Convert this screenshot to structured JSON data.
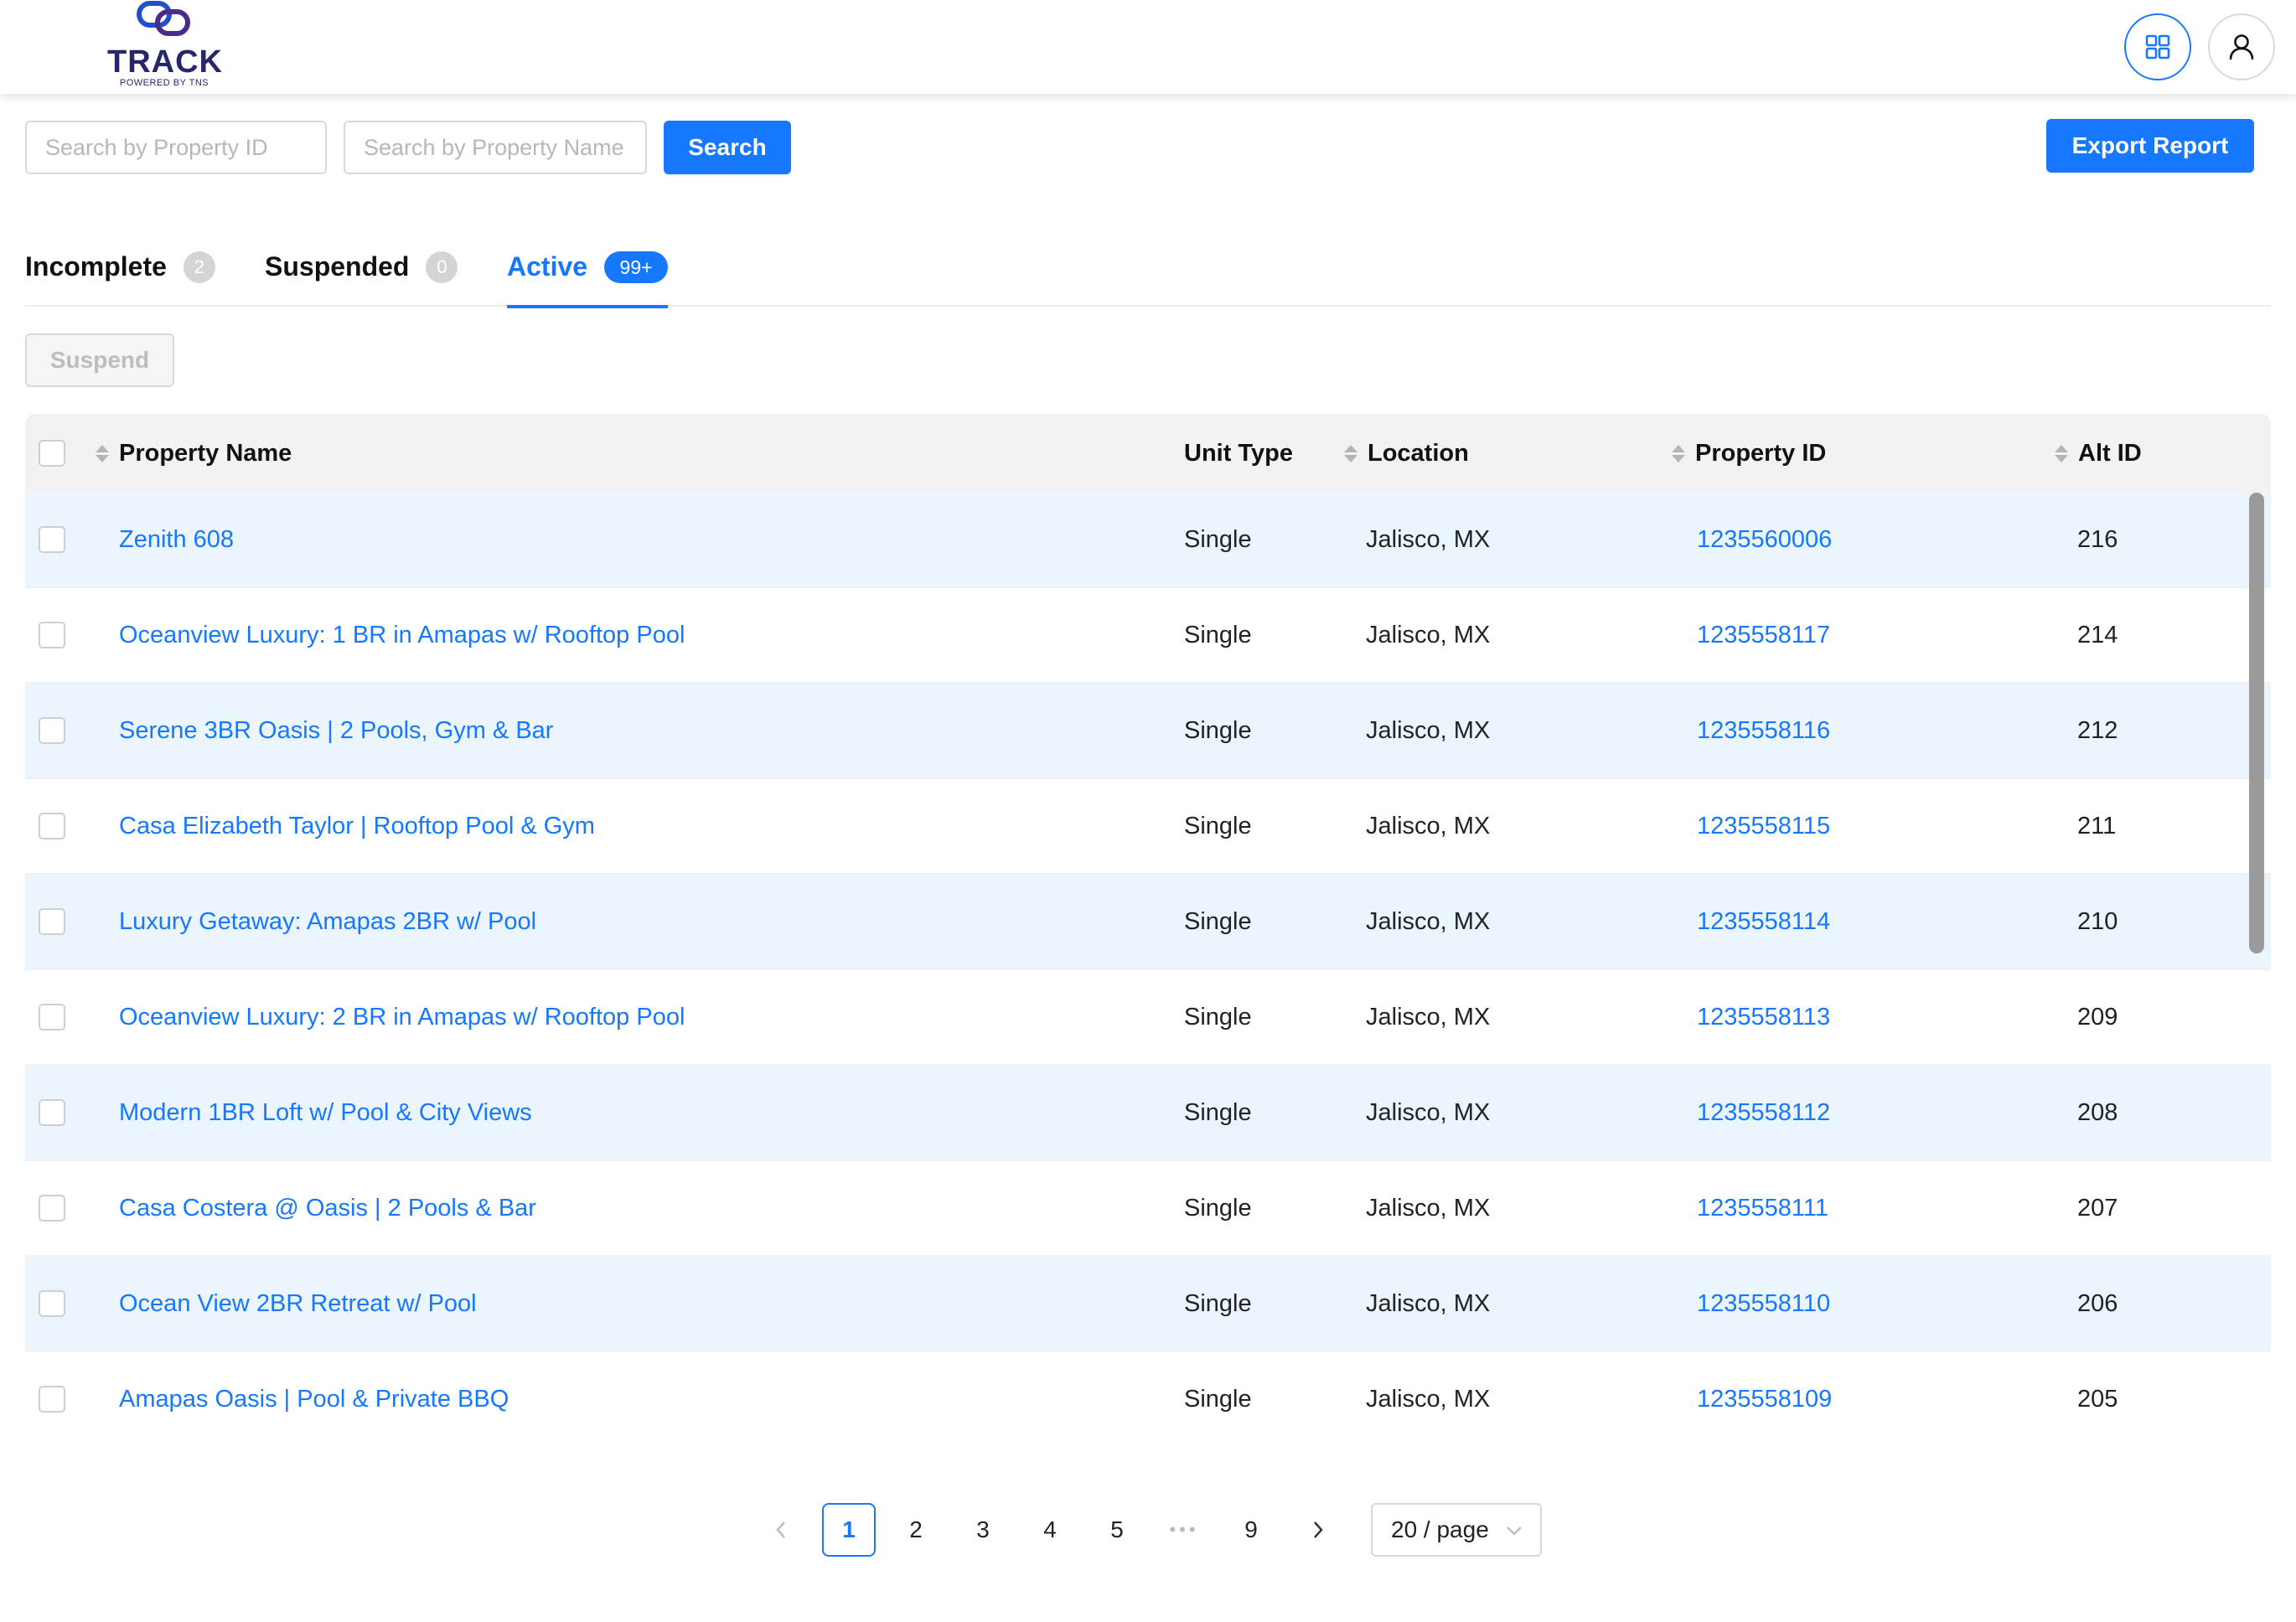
{
  "header": {
    "logo_text": "TRACK",
    "logo_sub": "POWERED BY TNS",
    "apps_icon": "grid-icon",
    "user_icon": "user-icon"
  },
  "toolbar": {
    "search_id_placeholder": "Search by Property ID",
    "search_name_placeholder": "Search by Property Name",
    "search_label": "Search",
    "export_label": "Export Report"
  },
  "tabs": [
    {
      "label": "Incomplete",
      "count": "2",
      "active": false
    },
    {
      "label": "Suspended",
      "count": "0",
      "active": false
    },
    {
      "label": "Active",
      "count": "99+",
      "active": true
    }
  ],
  "actions": {
    "suspend_label": "Suspend"
  },
  "table": {
    "columns": {
      "name": "Property Name",
      "unit_type": "Unit Type",
      "location": "Location",
      "property_id": "Property ID",
      "alt_id": "Alt ID"
    },
    "rows": [
      {
        "name": "Zenith 608",
        "unit_type": "Single",
        "location": "Jalisco, MX",
        "property_id": "1235560006",
        "alt_id": "216"
      },
      {
        "name": "Oceanview Luxury: 1 BR in Amapas w/ Rooftop Pool",
        "unit_type": "Single",
        "location": "Jalisco, MX",
        "property_id": "1235558117",
        "alt_id": "214"
      },
      {
        "name": "Serene 3BR Oasis | 2 Pools, Gym & Bar",
        "unit_type": "Single",
        "location": "Jalisco, MX",
        "property_id": "1235558116",
        "alt_id": "212"
      },
      {
        "name": "Casa Elizabeth Taylor | Rooftop Pool & Gym",
        "unit_type": "Single",
        "location": "Jalisco, MX",
        "property_id": "1235558115",
        "alt_id": "211"
      },
      {
        "name": "Luxury Getaway: Amapas 2BR w/ Pool",
        "unit_type": "Single",
        "location": "Jalisco, MX",
        "property_id": "1235558114",
        "alt_id": "210"
      },
      {
        "name": "Oceanview Luxury: 2 BR in Amapas w/ Rooftop Pool",
        "unit_type": "Single",
        "location": "Jalisco, MX",
        "property_id": "1235558113",
        "alt_id": "209"
      },
      {
        "name": "Modern 1BR Loft w/ Pool & City Views",
        "unit_type": "Single",
        "location": "Jalisco, MX",
        "property_id": "1235558112",
        "alt_id": "208"
      },
      {
        "name": "Casa Costera @ Oasis | 2 Pools & Bar",
        "unit_type": "Single",
        "location": "Jalisco, MX",
        "property_id": "1235558111",
        "alt_id": "207"
      },
      {
        "name": "Ocean View 2BR Retreat w/ Pool",
        "unit_type": "Single",
        "location": "Jalisco, MX",
        "property_id": "1235558110",
        "alt_id": "206"
      },
      {
        "name": "Amapas Oasis | Pool & Private BBQ",
        "unit_type": "Single",
        "location": "Jalisco, MX",
        "property_id": "1235558109",
        "alt_id": "205"
      }
    ]
  },
  "pagination": {
    "pages": [
      "1",
      "2",
      "3",
      "4",
      "5"
    ],
    "ellipsis": "•••",
    "last_page": "9",
    "current": "1",
    "page_size": "20 / page"
  },
  "colors": {
    "primary": "#1677ff",
    "row_alt": "#ebf5fd",
    "brand": "#26266b"
  }
}
